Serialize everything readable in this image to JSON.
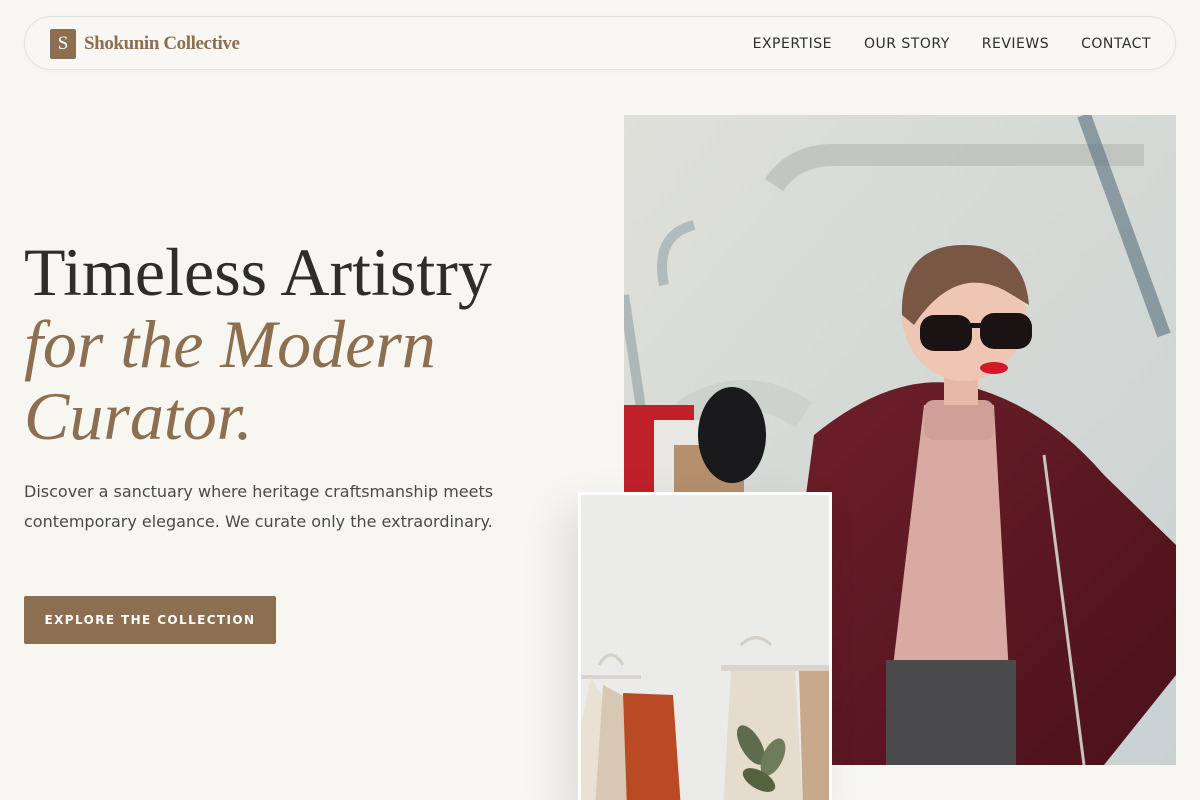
{
  "brand": {
    "mark": "S",
    "name": "Shokunin Collective"
  },
  "nav": {
    "items": [
      "EXPERTISE",
      "OUR STORY",
      "REVIEWS",
      "CONTACT"
    ]
  },
  "hero": {
    "title_line1": "Timeless Artistry",
    "title_line2": "for the Modern",
    "title_line3": "Curator.",
    "description": "Discover a sanctuary where heritage craftsmanship meets contemporary elegance. We curate only the extraordinary.",
    "cta_label": "EXPLORE THE COLLECTION"
  },
  "colors": {
    "accent": "#8b6f50",
    "background": "#f8f6f1",
    "text": "#2f2d2a"
  }
}
